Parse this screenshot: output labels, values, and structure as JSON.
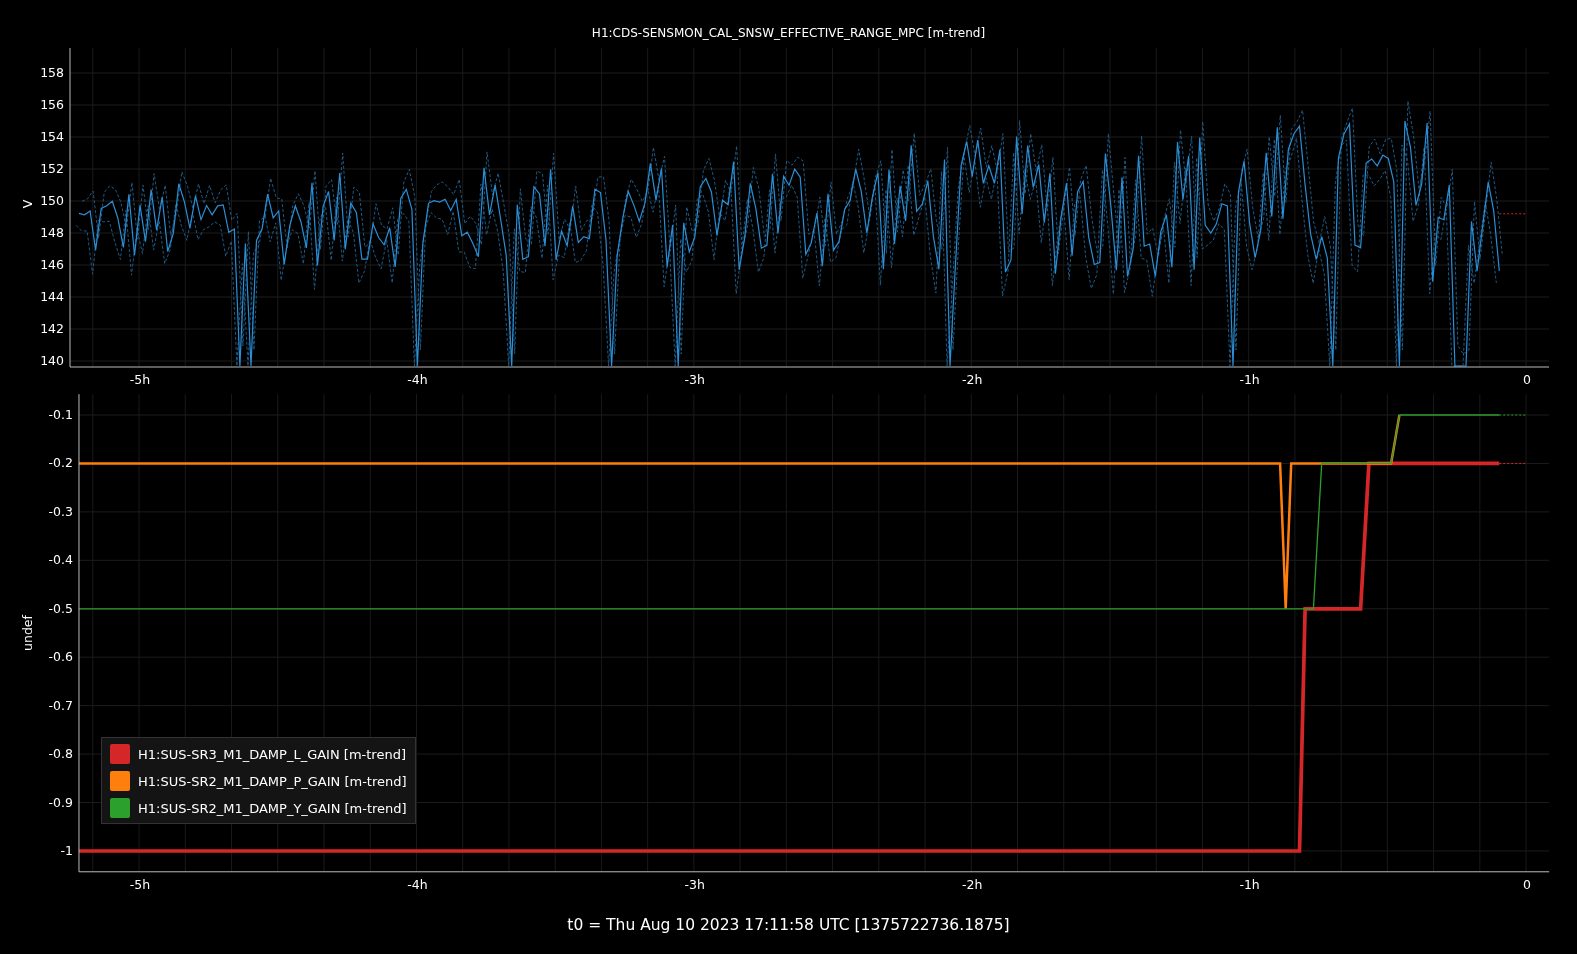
{
  "top_plot": {
    "title": "H1:CDS-SENSMON_CAL_SNSW_EFFECTIVE_RANGE_MPC [m-trend]",
    "y_axis_label": "V",
    "y_ticks": [
      "158",
      "156",
      "154",
      "152",
      "150",
      "148",
      "146",
      "144",
      "142",
      "140"
    ],
    "x_ticks": [
      "-5h",
      "-4h",
      "-3h",
      "-2h",
      "-1h",
      "0"
    ]
  },
  "bottom_plot": {
    "chart_data": {
      "type": "line",
      "ylabel": "undef",
      "x": [
        -5.22,
        -0.89,
        -0.87,
        -0.85,
        -0.82,
        -0.8,
        -0.77,
        -0.74,
        -0.6,
        -0.57,
        -0.49,
        -0.46,
        -0.1,
        0
      ],
      "series": [
        {
          "name": "H1:SUS-SR3_M1_DAMP_L_GAIN [m-trend]",
          "color": "#d62728",
          "values": [
            -1,
            -1,
            -1,
            -1,
            -1,
            -0.5,
            -0.5,
            -0.5,
            -0.5,
            -0.2,
            -0.2,
            -0.2,
            -0.2,
            -0.2
          ]
        },
        {
          "name": "H1:SUS-SR2_M1_DAMP_P_GAIN [m-trend]",
          "color": "#ff7f0e",
          "values": [
            -0.2,
            -0.2,
            -0.5,
            -0.2,
            -0.2,
            -0.2,
            -0.2,
            -0.2,
            -0.2,
            -0.2,
            -0.2,
            -0.1,
            null,
            null
          ]
        },
        {
          "name": "H1:SUS-SR2_M1_DAMP_Y_GAIN [m-trend]",
          "color": "#2ca02c",
          "values": [
            -0.5,
            -0.5,
            -0.5,
            -0.5,
            -0.5,
            -0.5,
            -0.5,
            -0.2,
            -0.2,
            -0.2,
            -0.2,
            -0.1,
            -0.1,
            -0.1
          ]
        }
      ],
      "xlim": [
        -5.22,
        0.08
      ],
      "ylim": [
        -1.043,
        -0.057
      ],
      "xticks": [
        {
          "value": -5,
          "label": "-5h"
        },
        {
          "value": -4,
          "label": "-4h"
        },
        {
          "value": -3,
          "label": "-3h"
        },
        {
          "value": -2,
          "label": "-2h"
        },
        {
          "value": -1,
          "label": "-1h"
        },
        {
          "value": 0,
          "label": "0"
        }
      ],
      "yticks": [
        -0.1,
        -0.2,
        -0.3,
        -0.4,
        -0.5,
        -0.6,
        -0.7,
        -0.8,
        -0.9,
        -1
      ],
      "grid": true
    }
  },
  "footer": "t0 = Thu Aug 10 2023 17:11:58 UTC [1375722736.1875]"
}
